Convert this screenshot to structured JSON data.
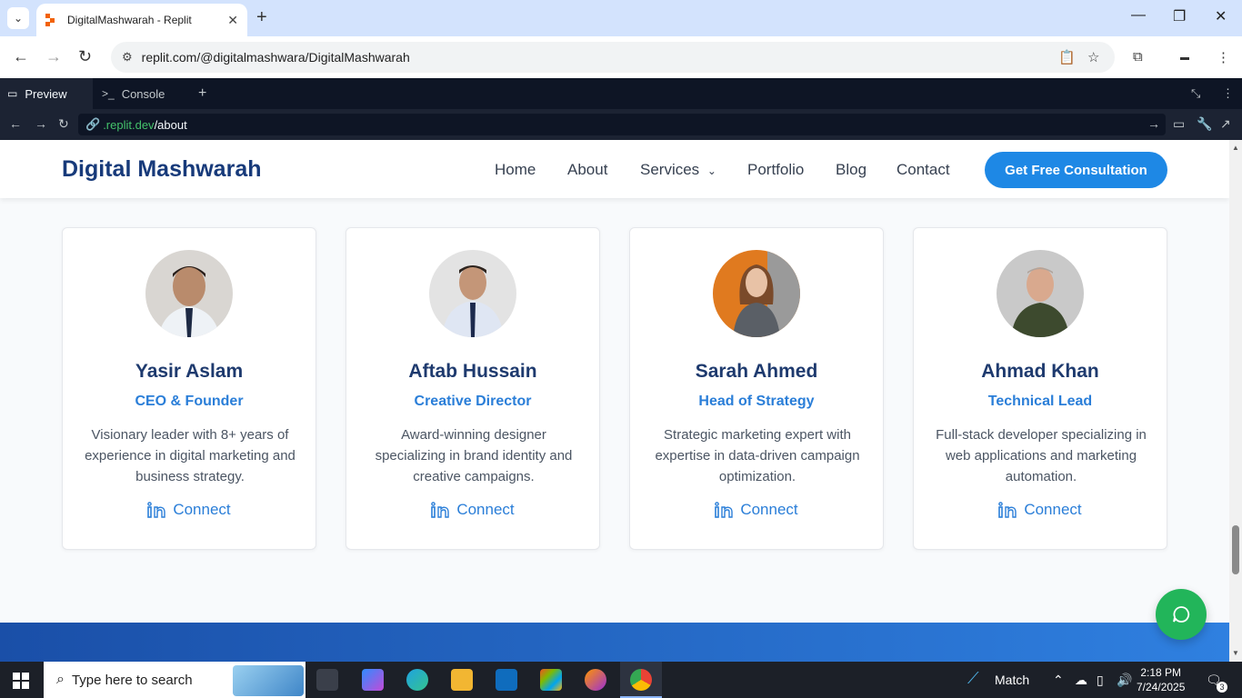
{
  "browser": {
    "tab_title": "DigitalMashwarah - Replit",
    "url": "replit.com/@digitalmashwara/DigitalMashwarah"
  },
  "replit": {
    "tabs": [
      {
        "label": "Preview"
      },
      {
        "label": "Console"
      }
    ],
    "url_domain": ".replit.dev",
    "url_path": "/about"
  },
  "site": {
    "brand": "Digital Mashwarah",
    "nav": [
      "Home",
      "About",
      "Services",
      "Portfolio",
      "Blog",
      "Contact"
    ],
    "cta": "Get Free Consultation",
    "team": [
      {
        "name": "Yasir Aslam",
        "role": "CEO & Founder",
        "bio": "Visionary leader with 8+ years of experience in digital marketing and business strategy.",
        "link": "Connect"
      },
      {
        "name": "Aftab Hussain",
        "role": "Creative Director",
        "bio": "Award-winning designer specializing in brand identity and creative campaigns.",
        "link": "Connect"
      },
      {
        "name": "Sarah Ahmed",
        "role": "Head of Strategy",
        "bio": "Strategic marketing expert with expertise in data-driven campaign optimization.",
        "link": "Connect"
      },
      {
        "name": "Ahmad Khan",
        "role": "Technical Lead",
        "bio": "Full-stack developer specializing in web applications and marketing automation.",
        "link": "Connect"
      }
    ]
  },
  "taskbar": {
    "search_placeholder": "Type here to search",
    "weather": "Match",
    "time": "2:18 PM",
    "date": "7/24/2025",
    "notifications": "3"
  },
  "colors": {
    "brand": "#173a7a",
    "accent": "#1e88e5",
    "chat": "#22b55a"
  }
}
